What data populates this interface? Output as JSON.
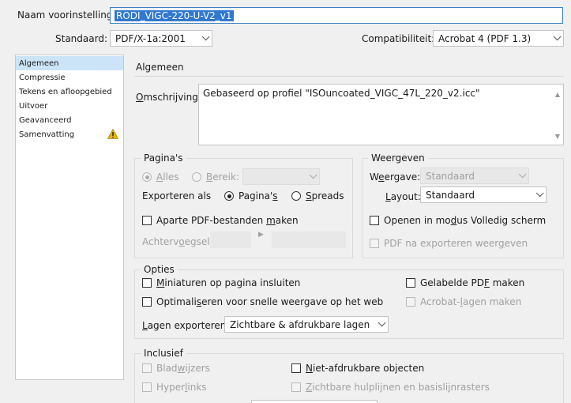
{
  "header": {
    "preset_label": "Naam voorinstelling:",
    "preset_value": "RODI_VIGC-220-U-V2_v1",
    "standard_label": "Standaard:",
    "standard_value": "PDF/X-1a:2001",
    "compat_label": "Compatibiliteit:",
    "compat_value": "Acrobat 4 (PDF 1.3)"
  },
  "sidebar": {
    "items": [
      {
        "label": "Algemeen"
      },
      {
        "label": "Compressie"
      },
      {
        "label": "Tekens en afloopgebied"
      },
      {
        "label": "Uitvoer"
      },
      {
        "label": "Geavanceerd"
      },
      {
        "label": "Samenvatting"
      }
    ],
    "selected_index": 0,
    "warning_icon": "warning-icon",
    "warning_color": "#e6b800"
  },
  "main": {
    "section_title": "Algemeen",
    "description_label": "Omschrijving:",
    "description_value": "Gebaseerd op profiel \"ISOuncoated_VIGC_47L_220_v2.icc\""
  },
  "pages": {
    "title": "Pagina's",
    "all_label": "Alles",
    "range_label": "Bereik:",
    "export_as_label": "Exporteren als",
    "pages_option": "Pagina's",
    "spreads_option": "Spreads",
    "separate_label": "Aparte PDF-bestanden maken",
    "suffix_label": "Achtervoegsel:"
  },
  "view": {
    "title": "Weergeven",
    "view_label": "Weergave:",
    "view_value": "Standaard",
    "layout_label": "Layout:",
    "layout_value": "Standaard",
    "fullscreen_label": "Openen in modus Volledig scherm",
    "view_after_label": "PDF na exporteren weergeven"
  },
  "options": {
    "title": "Opties",
    "thumbnails_label": "Miniaturen op pagina insluiten",
    "tagged_label": "Gelabelde PDF maken",
    "optimize_label": "Optimaliseren voor snelle weergave op het web",
    "acrobat_layers_label": "Acrobat-lagen maken",
    "export_layers_label": "Lagen exporteren:",
    "export_layers_value": "Zichtbare & afdrukbare lagen"
  },
  "include": {
    "title": "Inclusief",
    "bookmarks_label": "Bladwijzers",
    "nonprint_label": "Niet-afdrukbare objecten",
    "hyperlinks_label": "Hyperlinks",
    "guides_label": "Zichtbare hulplijnen en basislijnrasters"
  }
}
